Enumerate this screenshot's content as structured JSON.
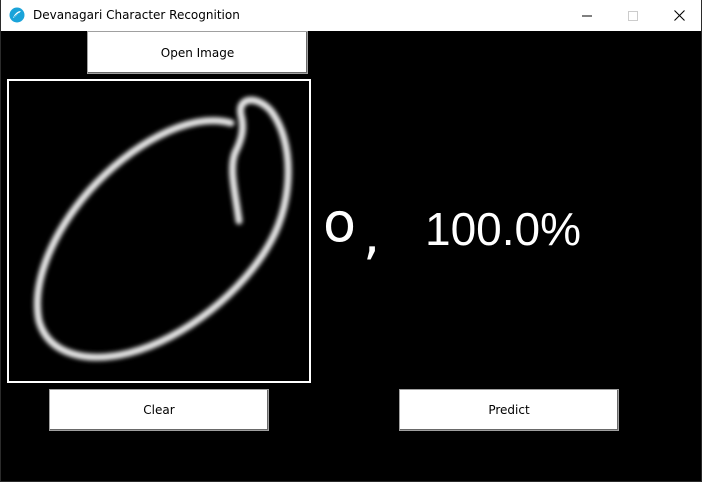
{
  "window": {
    "title": "Devanagari Character Recognition",
    "icon": "feather-app-icon",
    "controls": {
      "minimize": "minimize-icon",
      "maximize": "maximize-icon",
      "close": "close-icon"
    }
  },
  "toolbar": {
    "open_label": "Open Image"
  },
  "canvas": {
    "content": "handwritten-zero-drawing",
    "stroke_color": "#e6e6e6",
    "background": "#000000",
    "border_color": "#ffffff"
  },
  "prediction": {
    "character": "o",
    "separator": ",",
    "confidence": "100.0%"
  },
  "actions": {
    "clear_label": "Clear",
    "predict_label": "Predict"
  },
  "colors": {
    "background": "#000000",
    "titlebar": "#ffffff",
    "text_on_dark": "#ffffff",
    "app_icon": "#1aa3d9"
  }
}
